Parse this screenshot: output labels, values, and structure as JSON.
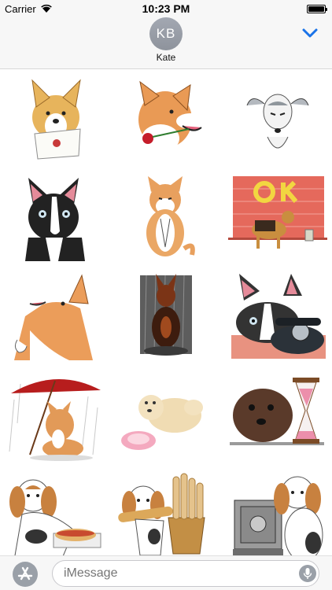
{
  "status": {
    "carrier": "Carrier",
    "time": "10:23 PM",
    "battery_level": 1.0
  },
  "contact": {
    "initials": "KB",
    "name": "Kate"
  },
  "icons": {
    "collapse": "chevron-down-icon",
    "app_store": "app-store-icon",
    "mic": "mic-icon",
    "wifi": "wifi-icon"
  },
  "input": {
    "placeholder": "iMessage"
  },
  "stickers": [
    "corgi-with-envelope",
    "shiba-with-rose",
    "whippet-eyes-closed",
    "boston-terrier",
    "shiba-praying",
    "airedale-ok-wall",
    "shiba-looking-up",
    "doberman-in-rain",
    "boston-terrier-with-phone",
    "shiba-with-red-umbrella",
    "poodle-with-bowl",
    "poodle-with-hourglass",
    "beagle-with-hotdog",
    "beagle-with-baguettes",
    "beagle-with-safe"
  ],
  "colors": {
    "accent": "#1a73e8",
    "bar_bg": "#f7f7f7",
    "avatar_bg": "#979ca5"
  }
}
